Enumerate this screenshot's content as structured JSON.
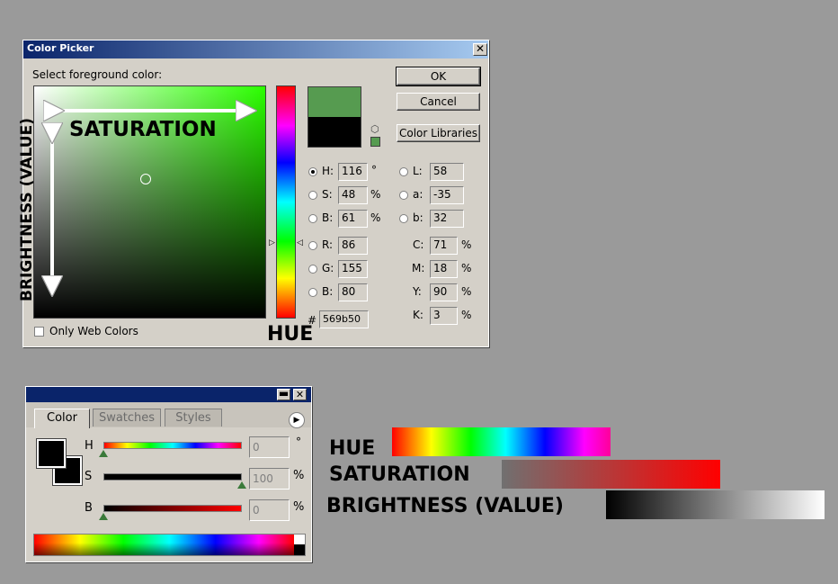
{
  "dialog": {
    "title": "Color Picker",
    "prompt": "Select foreground color:",
    "ok_label": "OK",
    "cancel_label": "Cancel",
    "libraries_label": "Color Libraries",
    "only_web_colors_label": "Only Web Colors",
    "only_web_colors_checked": false,
    "new_color": "#569b50",
    "old_color": "#000000",
    "hue_base_color": "#2bff00",
    "hsb": [
      {
        "label": "H:",
        "value": "116",
        "unit": "°",
        "selected": true
      },
      {
        "label": "S:",
        "value": "48",
        "unit": "%",
        "selected": false
      },
      {
        "label": "B:",
        "value": "61",
        "unit": "%",
        "selected": false
      }
    ],
    "rgb": [
      {
        "label": "R:",
        "value": "86"
      },
      {
        "label": "G:",
        "value": "155"
      },
      {
        "label": "B:",
        "value": "80"
      }
    ],
    "lab": [
      {
        "label": "L:",
        "value": "58"
      },
      {
        "label": "a:",
        "value": "-35"
      },
      {
        "label": "b:",
        "value": "32"
      }
    ],
    "cmyk": [
      {
        "label": "C:",
        "value": "71",
        "unit": "%"
      },
      {
        "label": "M:",
        "value": "18",
        "unit": "%"
      },
      {
        "label": "Y:",
        "value": "90",
        "unit": "%"
      },
      {
        "label": "K:",
        "value": "3",
        "unit": "%"
      }
    ],
    "hex_label": "#",
    "hex_value": "569b50"
  },
  "overlay": {
    "saturation": "SATURATION",
    "brightness_vertical": "BRIGHTNESS (VALUE)",
    "hue": "HUE"
  },
  "panel": {
    "tabs": [
      "Color",
      "Swatches",
      "Styles"
    ],
    "active_tab": "Color",
    "sliders": [
      {
        "label": "H",
        "value": "0",
        "unit": "°",
        "position": 0.0
      },
      {
        "label": "S",
        "value": "100",
        "unit": "%",
        "position": 1.0
      },
      {
        "label": "B",
        "value": "0",
        "unit": "%",
        "position": 0.0
      }
    ]
  },
  "legend": {
    "hue": "HUE",
    "saturation": "SATURATION",
    "brightness": "BRIGHTNESS (VALUE)"
  }
}
